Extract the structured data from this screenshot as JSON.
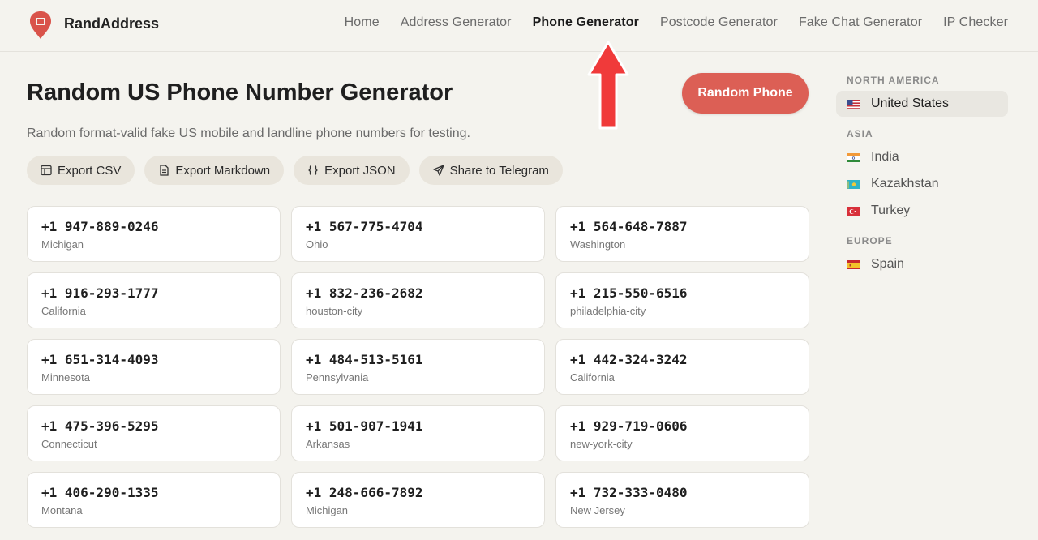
{
  "header": {
    "brand": "RandAddress",
    "nav": [
      "Home",
      "Address Generator",
      "Phone Generator",
      "Postcode Generator",
      "Fake Chat Generator",
      "IP Checker"
    ],
    "active_nav": "Phone Generator"
  },
  "main": {
    "title": "Random US Phone Number Generator",
    "subtitle": "Random format-valid fake US mobile and landline phone numbers for testing.",
    "random_button": "Random Phone",
    "actions": [
      "Export CSV",
      "Export Markdown",
      "Export JSON",
      "Share to Telegram"
    ],
    "numbers": [
      {
        "phone": "+1 947-889-0246",
        "region": "Michigan"
      },
      {
        "phone": "+1 567-775-4704",
        "region": "Ohio"
      },
      {
        "phone": "+1 564-648-7887",
        "region": "Washington"
      },
      {
        "phone": "+1 916-293-1777",
        "region": "California"
      },
      {
        "phone": "+1 832-236-2682",
        "region": "houston-city"
      },
      {
        "phone": "+1 215-550-6516",
        "region": "philadelphia-city"
      },
      {
        "phone": "+1 651-314-4093",
        "region": "Minnesota"
      },
      {
        "phone": "+1 484-513-5161",
        "region": "Pennsylvania"
      },
      {
        "phone": "+1 442-324-3242",
        "region": "California"
      },
      {
        "phone": "+1 475-396-5295",
        "region": "Connecticut"
      },
      {
        "phone": "+1 501-907-1941",
        "region": "Arkansas"
      },
      {
        "phone": "+1 929-719-0606",
        "region": "new-york-city"
      },
      {
        "phone": "+1 406-290-1335",
        "region": "Montana"
      },
      {
        "phone": "+1 248-666-7892",
        "region": "Michigan"
      },
      {
        "phone": "+1 732-333-0480",
        "region": "New Jersey"
      }
    ]
  },
  "sidebar": {
    "groups": [
      {
        "title": "NORTH AMERICA",
        "countries": [
          "United States"
        ]
      },
      {
        "title": "ASIA",
        "countries": [
          "India",
          "Kazakhstan",
          "Turkey"
        ]
      },
      {
        "title": "EUROPE",
        "countries": [
          "Spain"
        ]
      }
    ],
    "selected": "United States"
  },
  "colors": {
    "accent": "#dc5f55",
    "background": "#f4f3ee",
    "annotation_arrow": "#f03a3a"
  }
}
